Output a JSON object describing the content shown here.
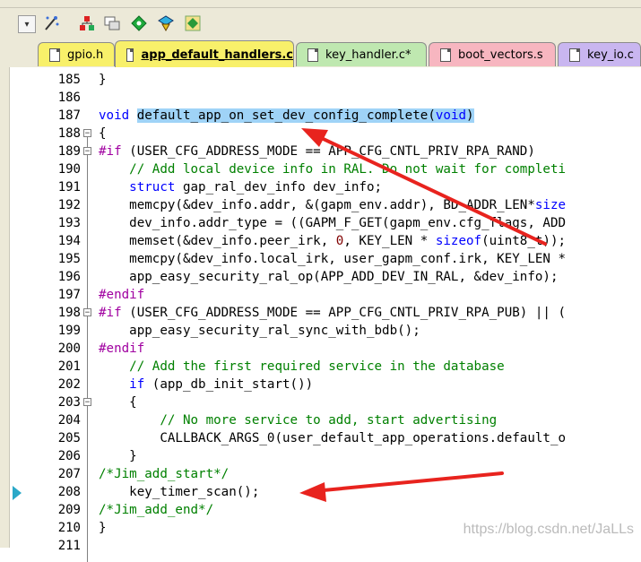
{
  "toolbar": {
    "items": [
      "dropdown-icon",
      "wand-icon",
      "project-icon",
      "windows-icon",
      "diamond-icon",
      "build-icon",
      "translate-icon"
    ]
  },
  "tabs": [
    {
      "label": "gpio.h",
      "color": "#f8f06a",
      "active": false
    },
    {
      "label": "app_default_handlers.c",
      "color": "#f8f06a",
      "active": true
    },
    {
      "label": "key_handler.c*",
      "color": "#bfe8b0",
      "active": false
    },
    {
      "label": "boot_vectors.s",
      "color": "#f7b6c0",
      "active": false
    },
    {
      "label": "key_io.c",
      "color": "#c9b6f0",
      "active": false
    }
  ],
  "lines": [
    {
      "n": "185",
      "t": "}"
    },
    {
      "n": "186",
      "t": ""
    },
    {
      "n": "187",
      "t": "void default_app_on_set_dev_config_complete(void)"
    },
    {
      "n": "188",
      "t": "{"
    },
    {
      "n": "189",
      "t": "#if (USER_CFG_ADDRESS_MODE == APP_CFG_CNTL_PRIV_RPA_RAND)"
    },
    {
      "n": "190",
      "t": "    // Add local device info in RAL. Do not wait for completi"
    },
    {
      "n": "191",
      "t": "    struct gap_ral_dev_info dev_info;"
    },
    {
      "n": "192",
      "t": "    memcpy(&dev_info.addr, &(gapm_env.addr), BD_ADDR_LEN*size"
    },
    {
      "n": "193",
      "t": "    dev_info.addr_type = ((GAPM_F_GET(gapm_env.cfg_flags, ADD"
    },
    {
      "n": "194",
      "t": "    memset(&dev_info.peer_irk, 0, KEY_LEN * sizeof(uint8_t));"
    },
    {
      "n": "195",
      "t": "    memcpy(&dev_info.local_irk, user_gapm_conf.irk, KEY_LEN *"
    },
    {
      "n": "196",
      "t": "    app_easy_security_ral_op(APP_ADD_DEV_IN_RAL, &dev_info);"
    },
    {
      "n": "197",
      "t": "#endif"
    },
    {
      "n": "198",
      "t": "#if (USER_CFG_ADDRESS_MODE == APP_CFG_CNTL_PRIV_RPA_PUB) || ("
    },
    {
      "n": "199",
      "t": "    app_easy_security_ral_sync_with_bdb();"
    },
    {
      "n": "200",
      "t": "#endif"
    },
    {
      "n": "201",
      "t": "    // Add the first required service in the database"
    },
    {
      "n": "202",
      "t": "    if (app_db_init_start())"
    },
    {
      "n": "203",
      "t": "    {"
    },
    {
      "n": "204",
      "t": "        // No more service to add, start advertising"
    },
    {
      "n": "205",
      "t": "        CALLBACK_ARGS_0(user_default_app_operations.default_o"
    },
    {
      "n": "206",
      "t": "    }"
    },
    {
      "n": "207",
      "t": "/*Jim_add_start*/"
    },
    {
      "n": "208",
      "t": "    key_timer_scan();"
    },
    {
      "n": "209",
      "t": "/*Jim_add_end*/"
    },
    {
      "n": "210",
      "t": "}"
    },
    {
      "n": "211",
      "t": ""
    }
  ],
  "watermark": "https://blog.csdn.net/JaLLs",
  "colors": {
    "keyword": "#0000ff",
    "preprocessor": "#a000a0",
    "comment": "#008000",
    "selection": "#9fd3f7",
    "arrow": "#e8231e"
  }
}
